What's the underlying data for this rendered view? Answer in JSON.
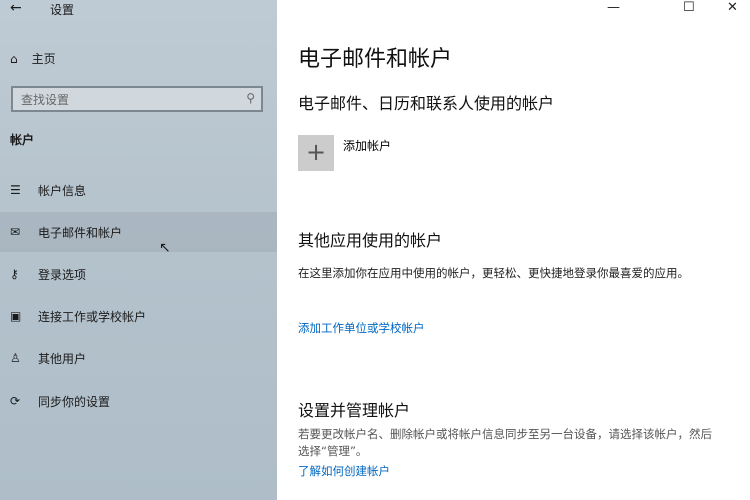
{
  "window": {
    "title": "设置",
    "minimize": "—",
    "maximize": "☐",
    "close": "✕"
  },
  "sidebar": {
    "home": "主页",
    "search_placeholder": "查找设置",
    "section": "帐户",
    "items": [
      {
        "label": "帐户信息",
        "icon": "person-list-icon"
      },
      {
        "label": "电子邮件和帐户",
        "icon": "mail-icon"
      },
      {
        "label": "登录选项",
        "icon": "key-icon"
      },
      {
        "label": "连接工作或学校帐户",
        "icon": "briefcase-icon"
      },
      {
        "label": "其他用户",
        "icon": "person-icon"
      },
      {
        "label": "同步你的设置",
        "icon": "sync-icon"
      }
    ]
  },
  "main": {
    "title": "电子邮件和帐户",
    "section1": {
      "heading": "电子邮件、日历和联系人使用的帐户",
      "add_label": "添加帐户"
    },
    "section2": {
      "heading": "其他应用使用的帐户",
      "desc": "在这里添加你在应用中使用的帐户，更轻松、更快捷地登录你最喜爱的应用。",
      "link": "添加工作单位或学校帐户"
    },
    "section3": {
      "heading": "设置并管理帐户",
      "desc": "若要更改帐户名、删除帐户或将帐户信息同步至另一台设备，请选择该帐户，然后选择“管理”。",
      "link": "了解如何创建帐户"
    }
  }
}
